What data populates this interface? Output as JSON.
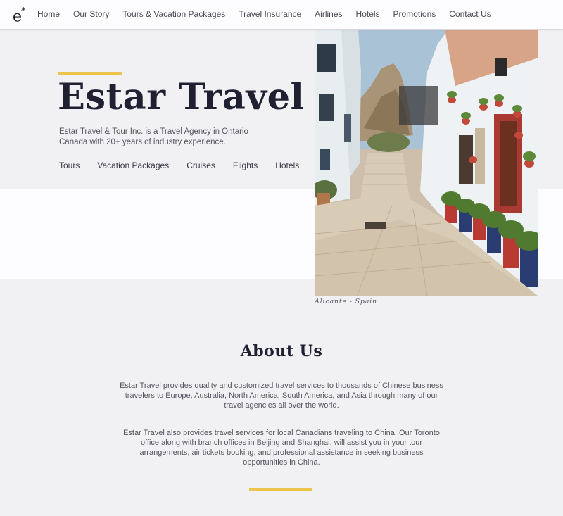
{
  "nav": {
    "logo_letter": "e",
    "logo_star": "*",
    "links": [
      "Home",
      "Our Story",
      "Tours & Vacation Packages",
      "Travel Insurance",
      "Airlines",
      "Hotels",
      "Promotions",
      "Contact Us"
    ]
  },
  "hero": {
    "title": "Estar Travel",
    "description": "Estar Travel & Tour Inc. is a Travel Agency in Ontario Canada with 20+ years of industry experience.",
    "links": [
      "Tours",
      "Vacation Packages",
      "Cruises",
      "Flights",
      "Hotels"
    ],
    "image_caption": "Alicante - Spain"
  },
  "about": {
    "title": "About Us",
    "paragraphs": [
      "Estar Travel provides quality and customized travel services to thousands of Chinese business travelers to Europe, Australia, North America, South America, and Asia through many of our travel agencies all over the world.",
      "Estar Travel also provides travel services for local Canadians traveling to China. Our Toronto office along with branch offices in Beijing and Shanghai, will assist you in your tour arrangements, air tickets booking, and professional assistance in seeking business opportunities in China."
    ]
  },
  "colors": {
    "accent": "#ecc54a",
    "heading": "#1f2032",
    "background": "#f1f0f3"
  }
}
